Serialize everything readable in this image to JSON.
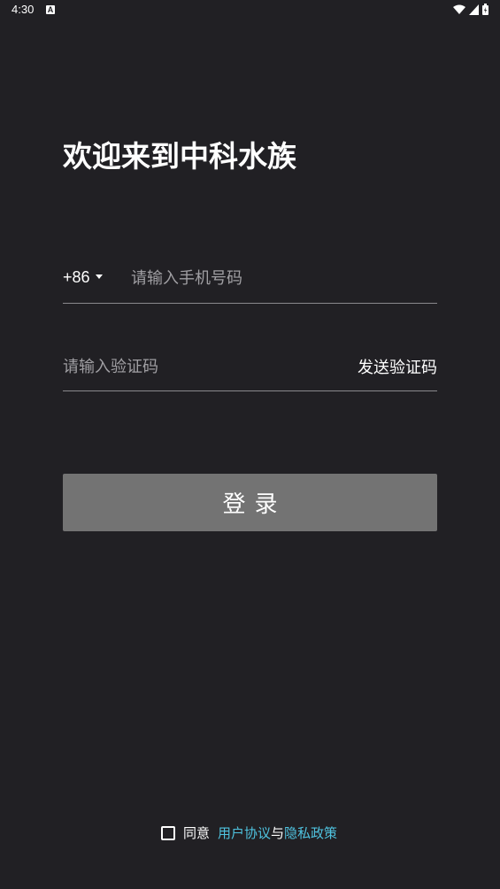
{
  "status_bar": {
    "time": "4:30",
    "notification_icon": "a-icon",
    "icons": [
      "wifi-icon",
      "signal-icon",
      "battery-icon"
    ]
  },
  "welcome_title": "欢迎来到中科水族",
  "phone": {
    "country_code": "+86",
    "placeholder": "请输入手机号码",
    "value": ""
  },
  "verification": {
    "placeholder": "请输入验证码",
    "value": "",
    "send_code_label": "发送验证码"
  },
  "login_label": "登录",
  "agreement": {
    "checked": false,
    "agree_label": "同意",
    "user_agreement": "用户协议",
    "and_label": "与",
    "privacy_policy": "隐私政策"
  },
  "colors": {
    "background": "#212024",
    "button": "#737373",
    "link": "#4fc3e0",
    "divider": "#8a898d"
  }
}
